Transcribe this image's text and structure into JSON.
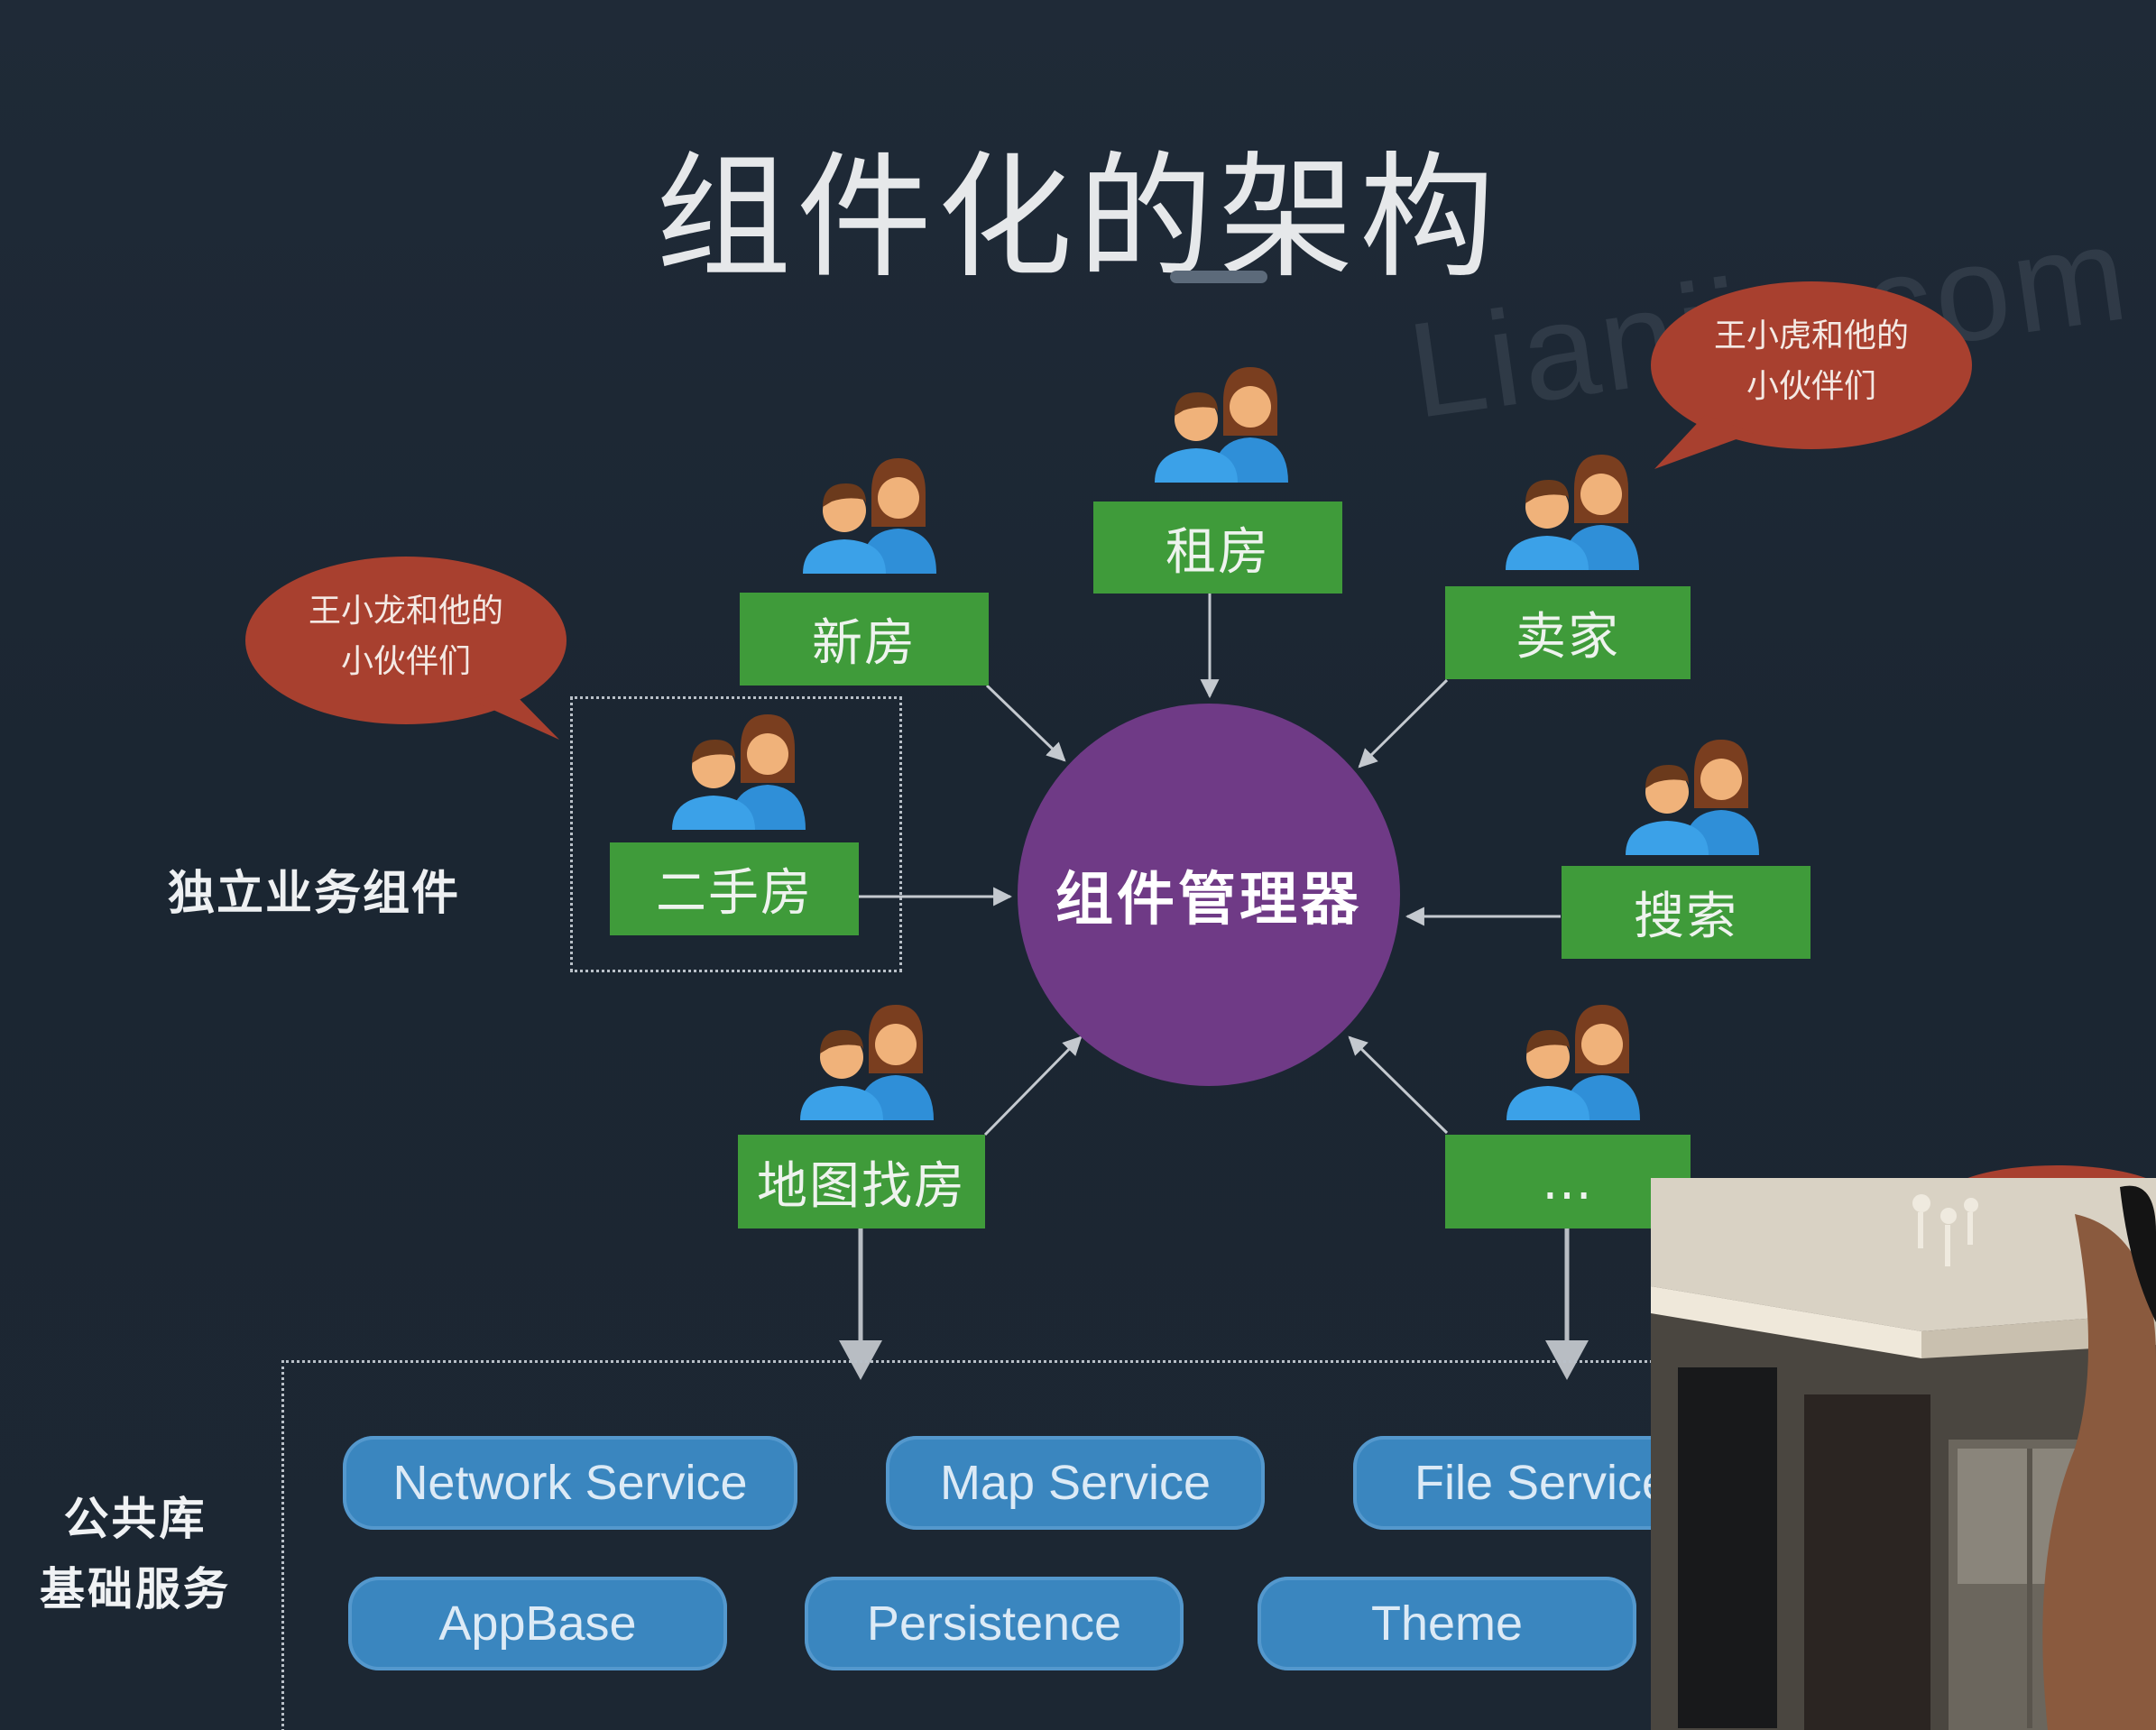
{
  "slide": {
    "title": "组件化的架构",
    "watermark": "Lianjia.com"
  },
  "manager": {
    "label": "组件管理器"
  },
  "components": {
    "zufang": "租房",
    "xinfang": "新房",
    "maijia": "卖家",
    "ershoufang": "二手房",
    "sousuo": "搜索",
    "ditu": "地图找房",
    "more": "…"
  },
  "labels": {
    "independent": "独立业务组件",
    "library_line1": "公共库",
    "library_line2": "基础服务"
  },
  "bubbles": {
    "left_line1": "王小龙和他的",
    "left_line2": "小伙伴们",
    "right_line1": "王小虎和他的",
    "right_line2": "小伙伴们"
  },
  "services": {
    "network": "Network Service",
    "map": "Map Service",
    "file": "File Service",
    "appbase": "AppBase",
    "persistence": "Persistence",
    "theme": "Theme"
  },
  "colors": {
    "background": "#1f2a37",
    "component_green": "#3f9b3a",
    "manager_purple": "#6f3a86",
    "service_blue": "#3a86bf",
    "bubble_red": "#a8402f"
  },
  "icons": {
    "team": "people-pair-icon",
    "bubble": "speech-bubble"
  }
}
